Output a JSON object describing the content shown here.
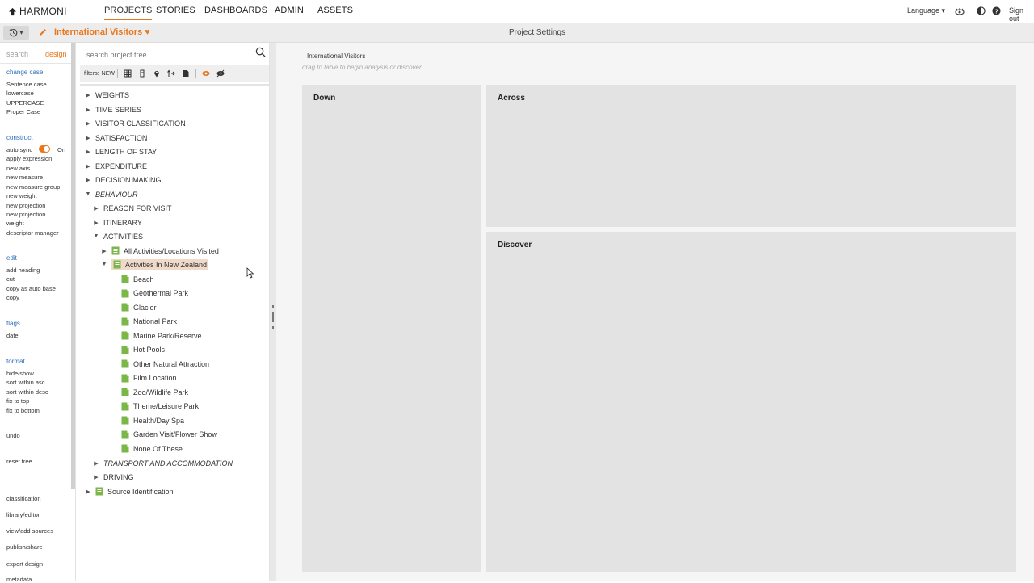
{
  "nav": {
    "logo": "HARMONI",
    "items": [
      "PROJECTS",
      "STORIES",
      "DASHBOARDS",
      "ADMIN",
      "ASSETS"
    ],
    "language": "Language ▾",
    "signout": "Sign out"
  },
  "subbar": {
    "history_caret": "▾",
    "project_title": "International Visitors",
    "heart": "♥",
    "settings": "Project Settings"
  },
  "left": {
    "tab_search": "search",
    "tab_design": "design",
    "change_case": "change case",
    "case_items": [
      "Sentence case",
      "lowercase",
      "UPPERCASE",
      "Proper Case"
    ],
    "construct": "construct",
    "auto_sync": "auto sync",
    "auto_sync_state": "On",
    "construct_items": [
      "apply expression",
      "new axis",
      "new measure",
      "new measure group",
      "new weight",
      "new projection",
      "new projection",
      "weight",
      "descriptor manager"
    ],
    "edit": "edit",
    "edit_items": [
      "add heading",
      "cut",
      "copy as auto base",
      "copy"
    ],
    "flags": "flags",
    "flag_items": [
      "date"
    ],
    "format": "format",
    "format_items": [
      "hide/show",
      "sort within asc",
      "sort within desc",
      "fix to top",
      "fix to bottom"
    ],
    "undo": "undo",
    "reset": "reset tree",
    "bottom_items": [
      "classification",
      "library/editor",
      "view/add sources",
      "publish/share",
      "export design",
      "metadata"
    ]
  },
  "tree": {
    "search_placeholder": "search project tree",
    "filters_label": "filters:",
    "filters_new": "NEW",
    "nodes": [
      {
        "label": "WEIGHTS"
      },
      {
        "label": "TIME SERIES"
      },
      {
        "label": "VISITOR CLASSIFICATION"
      },
      {
        "label": "SATISFACTION"
      },
      {
        "label": "LENGTH OF STAY"
      },
      {
        "label": "EXPENDITURE"
      },
      {
        "label": "DECISION MAKING"
      },
      {
        "label": "BEHAVIOUR"
      },
      {
        "label": "REASON FOR VISIT"
      },
      {
        "label": "ITINERARY"
      },
      {
        "label": "ACTIVITIES"
      },
      {
        "label": "All Activities/Locations Visited"
      },
      {
        "label": "Activities In New Zealand"
      },
      {
        "label": "Beach"
      },
      {
        "label": "Geothermal Park"
      },
      {
        "label": "Glacier"
      },
      {
        "label": "National Park"
      },
      {
        "label": "Marine Park/Reserve"
      },
      {
        "label": "Hot Pools"
      },
      {
        "label": "Other Natural Attraction"
      },
      {
        "label": "Film Location"
      },
      {
        "label": "Zoo/Wildlife Park"
      },
      {
        "label": "Theme/Leisure Park"
      },
      {
        "label": "Health/Day Spa"
      },
      {
        "label": "Garden Visit/Flower Show"
      },
      {
        "label": "None Of These"
      },
      {
        "label": "TRANSPORT AND ACCOMMODATION"
      },
      {
        "label": "DRIVING"
      },
      {
        "label": "Source Identification"
      }
    ]
  },
  "workspace": {
    "title": "International Visitors",
    "hint": "drag to table to begin analysis or discover",
    "down": "Down",
    "across": "Across",
    "discover": "Discover"
  },
  "colors": {
    "accent": "#e8771e",
    "link": "#2a6db8",
    "leaf_icon": "#7ab648"
  }
}
